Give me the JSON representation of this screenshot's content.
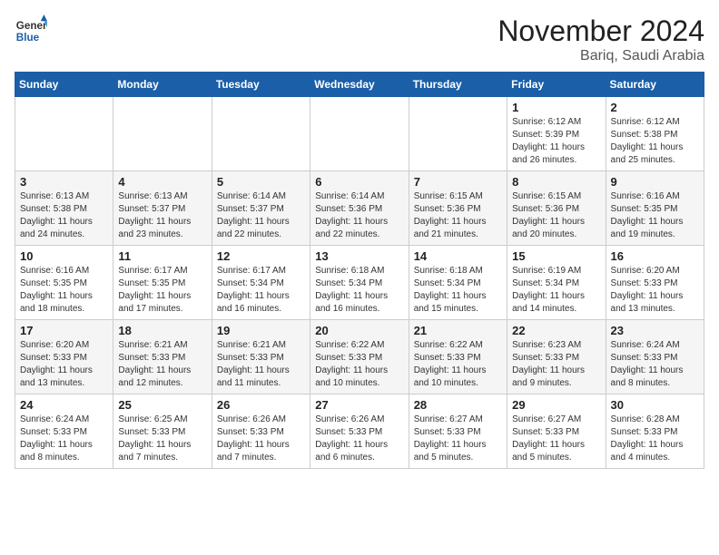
{
  "logo": {
    "line1": "General",
    "line2": "Blue"
  },
  "title": "November 2024",
  "location": "Bariq, Saudi Arabia",
  "days_of_week": [
    "Sunday",
    "Monday",
    "Tuesday",
    "Wednesday",
    "Thursday",
    "Friday",
    "Saturday"
  ],
  "weeks": [
    [
      {
        "day": "",
        "info": ""
      },
      {
        "day": "",
        "info": ""
      },
      {
        "day": "",
        "info": ""
      },
      {
        "day": "",
        "info": ""
      },
      {
        "day": "",
        "info": ""
      },
      {
        "day": "1",
        "info": "Sunrise: 6:12 AM\nSunset: 5:39 PM\nDaylight: 11 hours and 26 minutes."
      },
      {
        "day": "2",
        "info": "Sunrise: 6:12 AM\nSunset: 5:38 PM\nDaylight: 11 hours and 25 minutes."
      }
    ],
    [
      {
        "day": "3",
        "info": "Sunrise: 6:13 AM\nSunset: 5:38 PM\nDaylight: 11 hours and 24 minutes."
      },
      {
        "day": "4",
        "info": "Sunrise: 6:13 AM\nSunset: 5:37 PM\nDaylight: 11 hours and 23 minutes."
      },
      {
        "day": "5",
        "info": "Sunrise: 6:14 AM\nSunset: 5:37 PM\nDaylight: 11 hours and 22 minutes."
      },
      {
        "day": "6",
        "info": "Sunrise: 6:14 AM\nSunset: 5:36 PM\nDaylight: 11 hours and 22 minutes."
      },
      {
        "day": "7",
        "info": "Sunrise: 6:15 AM\nSunset: 5:36 PM\nDaylight: 11 hours and 21 minutes."
      },
      {
        "day": "8",
        "info": "Sunrise: 6:15 AM\nSunset: 5:36 PM\nDaylight: 11 hours and 20 minutes."
      },
      {
        "day": "9",
        "info": "Sunrise: 6:16 AM\nSunset: 5:35 PM\nDaylight: 11 hours and 19 minutes."
      }
    ],
    [
      {
        "day": "10",
        "info": "Sunrise: 6:16 AM\nSunset: 5:35 PM\nDaylight: 11 hours and 18 minutes."
      },
      {
        "day": "11",
        "info": "Sunrise: 6:17 AM\nSunset: 5:35 PM\nDaylight: 11 hours and 17 minutes."
      },
      {
        "day": "12",
        "info": "Sunrise: 6:17 AM\nSunset: 5:34 PM\nDaylight: 11 hours and 16 minutes."
      },
      {
        "day": "13",
        "info": "Sunrise: 6:18 AM\nSunset: 5:34 PM\nDaylight: 11 hours and 16 minutes."
      },
      {
        "day": "14",
        "info": "Sunrise: 6:18 AM\nSunset: 5:34 PM\nDaylight: 11 hours and 15 minutes."
      },
      {
        "day": "15",
        "info": "Sunrise: 6:19 AM\nSunset: 5:34 PM\nDaylight: 11 hours and 14 minutes."
      },
      {
        "day": "16",
        "info": "Sunrise: 6:20 AM\nSunset: 5:33 PM\nDaylight: 11 hours and 13 minutes."
      }
    ],
    [
      {
        "day": "17",
        "info": "Sunrise: 6:20 AM\nSunset: 5:33 PM\nDaylight: 11 hours and 13 minutes."
      },
      {
        "day": "18",
        "info": "Sunrise: 6:21 AM\nSunset: 5:33 PM\nDaylight: 11 hours and 12 minutes."
      },
      {
        "day": "19",
        "info": "Sunrise: 6:21 AM\nSunset: 5:33 PM\nDaylight: 11 hours and 11 minutes."
      },
      {
        "day": "20",
        "info": "Sunrise: 6:22 AM\nSunset: 5:33 PM\nDaylight: 11 hours and 10 minutes."
      },
      {
        "day": "21",
        "info": "Sunrise: 6:22 AM\nSunset: 5:33 PM\nDaylight: 11 hours and 10 minutes."
      },
      {
        "day": "22",
        "info": "Sunrise: 6:23 AM\nSunset: 5:33 PM\nDaylight: 11 hours and 9 minutes."
      },
      {
        "day": "23",
        "info": "Sunrise: 6:24 AM\nSunset: 5:33 PM\nDaylight: 11 hours and 8 minutes."
      }
    ],
    [
      {
        "day": "24",
        "info": "Sunrise: 6:24 AM\nSunset: 5:33 PM\nDaylight: 11 hours and 8 minutes."
      },
      {
        "day": "25",
        "info": "Sunrise: 6:25 AM\nSunset: 5:33 PM\nDaylight: 11 hours and 7 minutes."
      },
      {
        "day": "26",
        "info": "Sunrise: 6:26 AM\nSunset: 5:33 PM\nDaylight: 11 hours and 7 minutes."
      },
      {
        "day": "27",
        "info": "Sunrise: 6:26 AM\nSunset: 5:33 PM\nDaylight: 11 hours and 6 minutes."
      },
      {
        "day": "28",
        "info": "Sunrise: 6:27 AM\nSunset: 5:33 PM\nDaylight: 11 hours and 5 minutes."
      },
      {
        "day": "29",
        "info": "Sunrise: 6:27 AM\nSunset: 5:33 PM\nDaylight: 11 hours and 5 minutes."
      },
      {
        "day": "30",
        "info": "Sunrise: 6:28 AM\nSunset: 5:33 PM\nDaylight: 11 hours and 4 minutes."
      }
    ]
  ]
}
